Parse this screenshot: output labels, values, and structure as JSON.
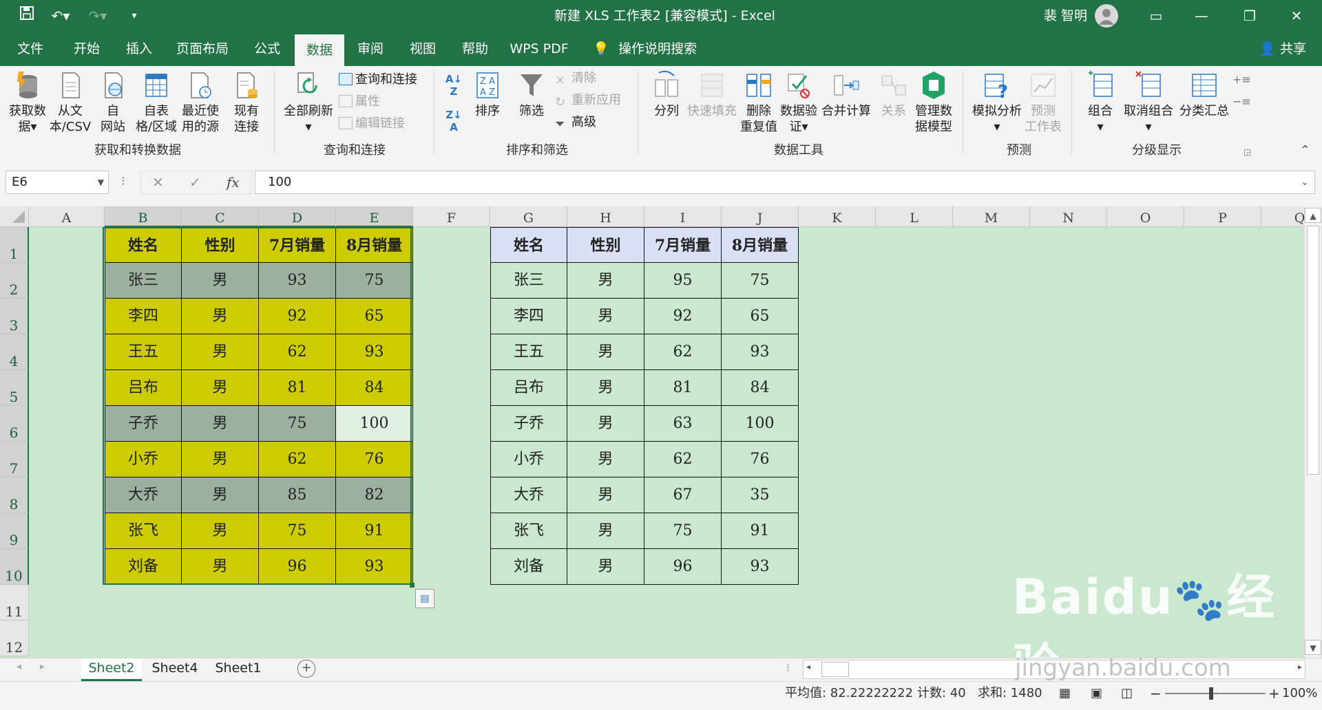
{
  "window": {
    "title": "新建 XLS 工作表2 [兼容模式] - Excel",
    "user": "裴 智明",
    "colors": {
      "brand": "#217346",
      "grid_bg": "#c9e8cd",
      "yellow": "#cccc00",
      "gray": "#9bb09f"
    }
  },
  "tabs": [
    "文件",
    "开始",
    "插入",
    "页面布局",
    "公式",
    "数据",
    "审阅",
    "视图",
    "帮助",
    "WPS PDF",
    "操作说明搜索"
  ],
  "share_label": "共享",
  "ribbon": {
    "get": {
      "buttons": [
        [
          "获取数",
          "据"
        ],
        [
          "从文",
          "本/CSV"
        ],
        [
          "自",
          "网站"
        ],
        [
          "自表",
          "格/区域"
        ],
        [
          "最近使",
          "用的源"
        ],
        [
          "现有",
          "连接"
        ]
      ],
      "group": "获取和转换数据"
    },
    "query": {
      "refresh": "全部刷新",
      "items": [
        "查询和连接",
        "属性",
        "编辑链接"
      ],
      "group": "查询和连接"
    },
    "sort": {
      "sort": "排序",
      "filter": "筛选",
      "items": [
        "清除",
        "重新应用",
        "高级"
      ],
      "group": "排序和筛选"
    },
    "tools": {
      "buttons": [
        [
          "分列"
        ],
        [
          "快速填充"
        ],
        [
          "删除",
          "重复值"
        ],
        [
          "数据验",
          "证"
        ],
        [
          "合并计算"
        ],
        [
          "关系"
        ],
        [
          "管理数",
          "据模型"
        ]
      ],
      "group": "数据工具"
    },
    "forecast": {
      "buttons": [
        [
          "模拟分析"
        ],
        [
          "预测",
          "工作表"
        ]
      ],
      "group": "预测"
    },
    "outline": {
      "buttons": [
        [
          "组合"
        ],
        [
          "取消组合"
        ],
        [
          "分类汇总"
        ]
      ],
      "group": "分级显示"
    }
  },
  "formula_bar": {
    "name_box": "E6",
    "fx": "fx",
    "value": "100"
  },
  "columns": [
    "A",
    "B",
    "C",
    "D",
    "E",
    "F",
    "G",
    "H",
    "I",
    "J",
    "K",
    "L",
    "M",
    "N",
    "O",
    "P",
    "Q"
  ],
  "rows": [
    "1",
    "2",
    "3",
    "4",
    "5",
    "6",
    "7",
    "8",
    "9",
    "10",
    "11",
    "12"
  ],
  "table1": {
    "headers": [
      "姓名",
      "性别",
      "7月销量",
      "8月销量"
    ],
    "rows": [
      [
        "张三",
        "男",
        "93",
        "75"
      ],
      [
        "李四",
        "男",
        "92",
        "65"
      ],
      [
        "王五",
        "男",
        "62",
        "93"
      ],
      [
        "吕布",
        "男",
        "81",
        "84"
      ],
      [
        "子乔",
        "男",
        "75",
        "100"
      ],
      [
        "小乔",
        "男",
        "62",
        "76"
      ],
      [
        "大乔",
        "男",
        "85",
        "82"
      ],
      [
        "张飞",
        "男",
        "75",
        "91"
      ],
      [
        "刘备",
        "男",
        "96",
        "93"
      ]
    ]
  },
  "table2": {
    "headers": [
      "姓名",
      "性别",
      "7月销量",
      "8月销量"
    ],
    "rows": [
      [
        "张三",
        "男",
        "95",
        "75"
      ],
      [
        "李四",
        "男",
        "92",
        "65"
      ],
      [
        "王五",
        "男",
        "62",
        "93"
      ],
      [
        "吕布",
        "男",
        "81",
        "84"
      ],
      [
        "子乔",
        "男",
        "63",
        "100"
      ],
      [
        "小乔",
        "男",
        "62",
        "76"
      ],
      [
        "大乔",
        "男",
        "67",
        "35"
      ],
      [
        "张飞",
        "男",
        "75",
        "91"
      ],
      [
        "刘备",
        "男",
        "96",
        "93"
      ]
    ]
  },
  "sheets": [
    "Sheet2",
    "Sheet4",
    "Sheet1"
  ],
  "status": {
    "average": "平均值: 82.22222222",
    "count": "计数: 40",
    "sum": "求和: 1480",
    "zoom": "100%"
  },
  "watermark": {
    "brand": "Baidu",
    "cn": "经验",
    "url": "jingyan.baidu.com"
  }
}
